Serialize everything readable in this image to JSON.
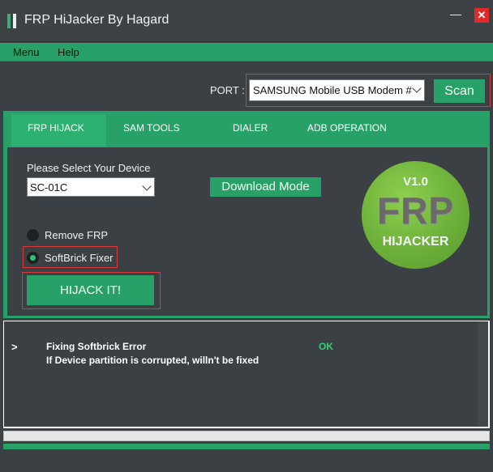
{
  "window": {
    "title": "FRP HiJacker By Hagard",
    "minimize_glyph": "—",
    "close_glyph": "✕",
    "accent_color": "#27a167",
    "close_color": "#e02a2a"
  },
  "menu": {
    "items": [
      {
        "label": "Menu"
      },
      {
        "label": "Help"
      }
    ]
  },
  "port": {
    "label": "PORT :",
    "selected": "SAMSUNG Mobile USB Modem #",
    "scan_label": "Scan"
  },
  "tabs": [
    {
      "label": "FRP HIJACK",
      "active": true
    },
    {
      "label": "SAM TOOLS",
      "active": false
    },
    {
      "label": "DIALER",
      "active": false
    },
    {
      "label": "ADB OPERATION",
      "active": false
    }
  ],
  "frp_hijack": {
    "device_label": "Please Select Your Device",
    "device_selected": "SC-01C",
    "download_mode_label": "Download Mode",
    "options": [
      {
        "label": "Remove FRP",
        "checked": false
      },
      {
        "label": "SoftBrick Fixer",
        "checked": true
      }
    ],
    "hijack_label": "HIJACK IT!"
  },
  "logo": {
    "version": "V1.0",
    "main": "FRP",
    "sub": "HIJACKER"
  },
  "log": {
    "prompt": ">",
    "line1": "Fixing Softbrick Error",
    "line2": "If Device partition is corrupted, willn't be fixed",
    "status": "OK"
  },
  "progress": {
    "value_percent": 0
  }
}
